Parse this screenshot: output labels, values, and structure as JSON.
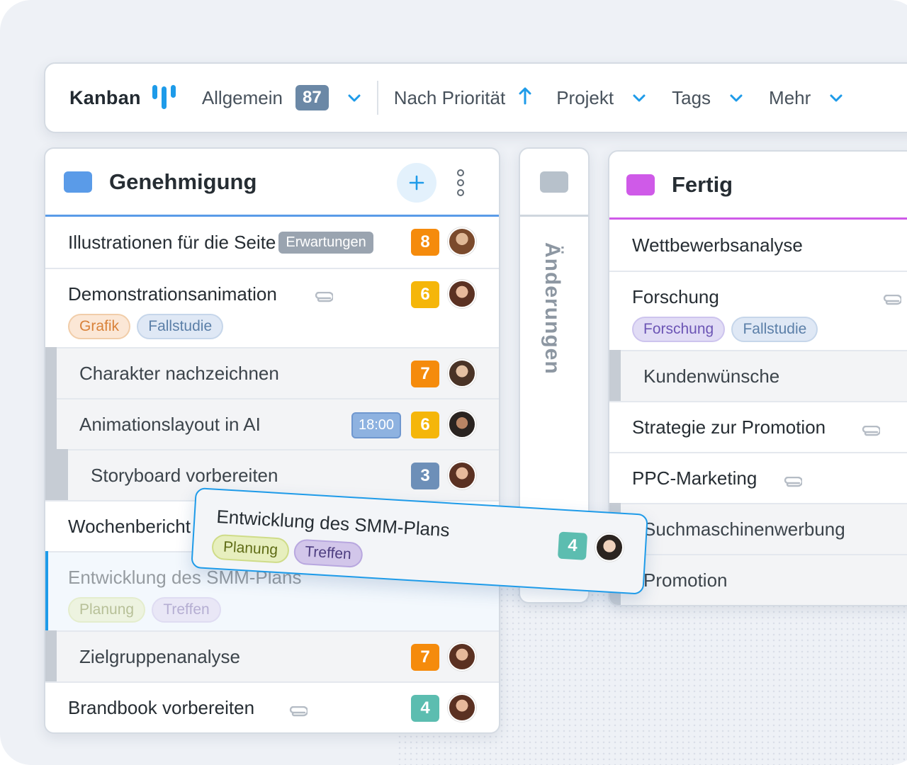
{
  "toolbar": {
    "title": "Kanban",
    "filter_label": "Allgemein",
    "filter_count": "87",
    "sort_label": "Nach Priorität",
    "project_label": "Projekt",
    "tags_label": "Tags",
    "more_label": "Mehr"
  },
  "columns": {
    "approval": {
      "title": "Genehmigung",
      "color": "#5a9be8",
      "cards": [
        {
          "title": "Illustrationen für die Seite",
          "tag": "Erwartungen",
          "priority": "8"
        },
        {
          "title": "Demonstrationsanimation",
          "tags": [
            "Grafik",
            "Fallstudie"
          ],
          "priority": "6"
        },
        {
          "title": "Charakter nachzeichnen",
          "priority": "7"
        },
        {
          "title": "Animationslayout in AI",
          "time": "18:00",
          "priority": "6"
        },
        {
          "title": "Storyboard vorbereiten",
          "priority": "3"
        },
        {
          "title": "Wochenbericht"
        },
        {
          "title": "Entwicklung des SMM-Plans",
          "tags": [
            "Planung",
            "Treffen"
          ]
        },
        {
          "title": "Zielgruppenanalyse",
          "priority": "7"
        },
        {
          "title": "Brandbook vorbereiten",
          "priority": "4"
        }
      ]
    },
    "changes": {
      "title": "Änderungen",
      "color": "#b7c1cb"
    },
    "done": {
      "title": "Fertig",
      "color": "#cf5ae8",
      "cards": [
        {
          "title": "Wettbewerbsanalyse"
        },
        {
          "title": "Forschung",
          "tags": [
            "Forschung",
            "Fallstudie"
          ]
        },
        {
          "title": "Kundenwünsche"
        },
        {
          "title": "Strategie zur Promotion"
        },
        {
          "title": "PPC-Marketing"
        },
        {
          "title": "Suchmaschinenwerbung"
        },
        {
          "title": "Promotion"
        }
      ]
    }
  },
  "dragged_card": {
    "title": "Entwicklung des SMM-Plans",
    "tags": [
      "Planung",
      "Treffen"
    ],
    "priority": "4"
  },
  "colors": {
    "priority_orange": "#f58b0c",
    "priority_yellow": "#f5b60a",
    "priority_blue": "#6d8fb8",
    "priority_teal": "#5cbdb0",
    "accent_blue": "#1e9be9"
  }
}
